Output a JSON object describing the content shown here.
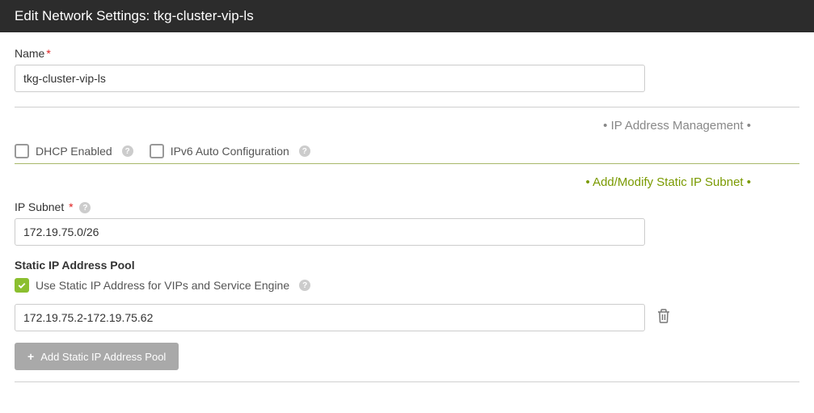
{
  "header": {
    "title": "Edit Network Settings: tkg-cluster-vip-ls"
  },
  "name": {
    "label": "Name",
    "value": "tkg-cluster-vip-ls"
  },
  "sections": {
    "ip_mgmt": "IP Address Management",
    "static_subnet": "Add/Modify Static IP Subnet"
  },
  "dhcp": {
    "label": "DHCP Enabled"
  },
  "ipv6": {
    "label": "IPv6 Auto Configuration"
  },
  "subnet": {
    "label": "IP Subnet",
    "value": "172.19.75.0/26"
  },
  "pool": {
    "heading": "Static IP Address Pool",
    "use_static_label": "Use Static IP Address for VIPs and Service Engine",
    "range_value": "172.19.75.2-172.19.75.62",
    "add_button": "Add Static IP Address Pool"
  }
}
